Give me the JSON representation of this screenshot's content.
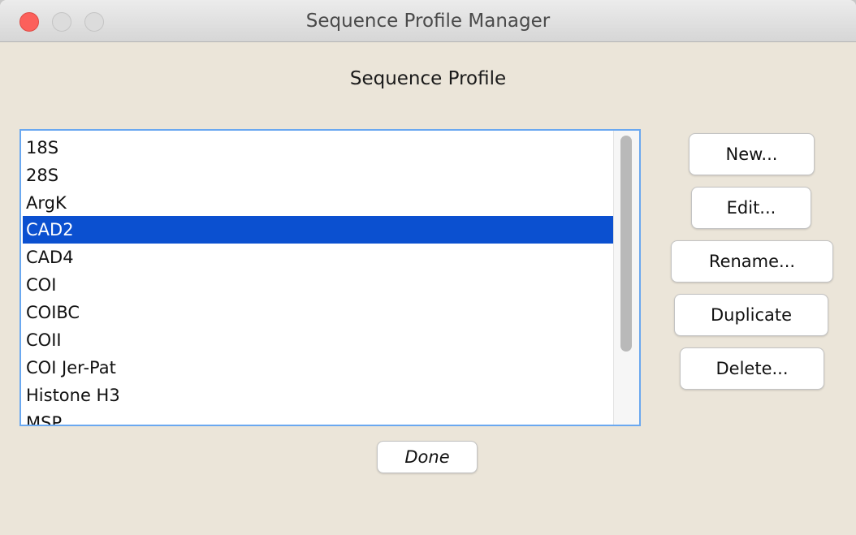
{
  "window": {
    "title": "Sequence Profile Manager"
  },
  "section_title": "Sequence Profile",
  "profiles": [
    "18S",
    "28S",
    "ArgK",
    "CAD2",
    "CAD4",
    "COI",
    "COIBC",
    "COII",
    "COI Jer-Pat",
    "Histone H3",
    "MSP"
  ],
  "selected_profile": "CAD2",
  "buttons": {
    "new": "New...",
    "edit": "Edit...",
    "rename": "Rename...",
    "duplicate": "Duplicate",
    "delete": "Delete...",
    "done": "Done"
  },
  "colors": {
    "selection": "#0b50d0",
    "window_bg": "#ebe5d9",
    "close_button": "#fc605b"
  }
}
